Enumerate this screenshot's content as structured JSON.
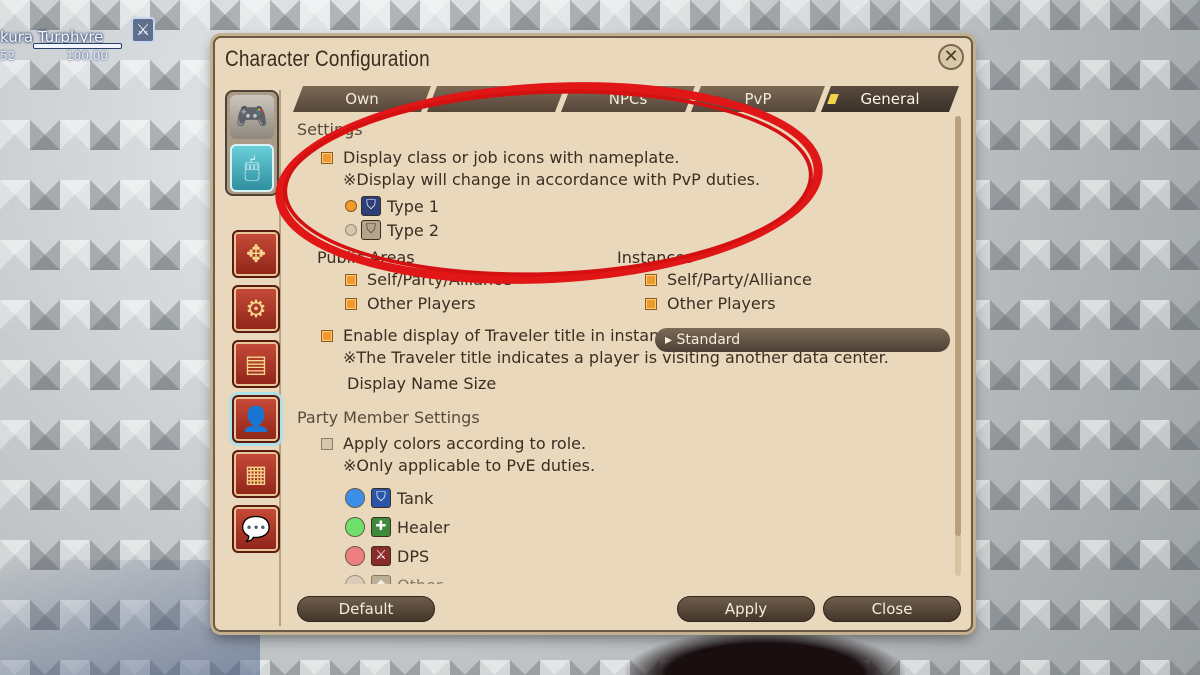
{
  "hud": {
    "player_name": "kura Turphyre",
    "level_left": "52",
    "hp_value": "100.00"
  },
  "window": {
    "title": "Character Configuration"
  },
  "tabs": [
    {
      "label": "Own"
    },
    {
      "label": ""
    },
    {
      "label": "NPCs"
    },
    {
      "label": "PvP"
    },
    {
      "label": "General"
    }
  ],
  "settings": {
    "header": "Settings",
    "class_icons_label": "Display class or job icons with nameplate.",
    "class_icons_note": "※Display will change in accordance with PvP duties.",
    "type1": "Type 1",
    "type2": "Type 2",
    "public_areas": "Public Areas",
    "instances": "Instances",
    "public_self": "Self/Party/Alliance",
    "public_other": "Other Players",
    "inst_self": "Self/Party/Alliance",
    "inst_other": "Other Players",
    "traveler_label": "Enable display of Traveler title in instanced duties.",
    "traveler_note": "※The Traveler title indicates a player is visiting another data center.",
    "name_size_label": "Display Name Size",
    "name_size_value": "Standard"
  },
  "party": {
    "header": "Party Member Settings",
    "role_colors_label": "Apply colors according to role.",
    "role_colors_note": "※Only applicable to PvE duties.",
    "roles": [
      {
        "label": "Tank",
        "color": "#3d8ee8"
      },
      {
        "label": "Healer",
        "color": "#6fe06a"
      },
      {
        "label": "DPS",
        "color": "#ee7f80"
      },
      {
        "label": "Other",
        "color": "#cfc4b2"
      }
    ]
  },
  "footer": {
    "default": "Default",
    "apply": "Apply",
    "close": "Close"
  },
  "colors": {
    "accent": "#f09a2b",
    "annotation": "#e11616",
    "panel": "#e9d8bc"
  }
}
